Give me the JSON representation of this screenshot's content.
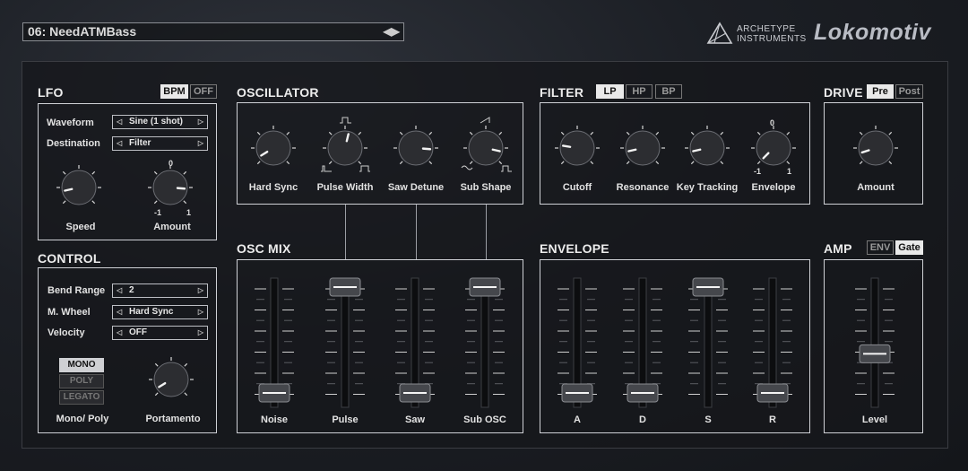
{
  "preset": {
    "name": "06: NeedATMBass",
    "arrows": "◀▶"
  },
  "brand": {
    "line1": "ARCHETYPE",
    "line2": "INSTRUMENTS",
    "product": "Lokomotiv"
  },
  "lfo": {
    "title": "LFO",
    "toggles": [
      {
        "label": "BPM",
        "on": true
      },
      {
        "label": "OFF",
        "on": false
      }
    ],
    "rows": [
      {
        "label": "Waveform",
        "value": "Sine (1 shot)"
      },
      {
        "label": "Destination",
        "value": "Filter"
      }
    ],
    "knobs": [
      {
        "label": "Speed",
        "value": 0.12
      },
      {
        "label": "Amount",
        "value": 0.85,
        "top": "0",
        "min": "-1",
        "max": "1"
      }
    ]
  },
  "control": {
    "title": "CONTROL",
    "rows": [
      {
        "label": "Bend Range",
        "value": "2"
      },
      {
        "label": "M. Wheel",
        "value": "Hard Sync"
      },
      {
        "label": "Velocity",
        "value": "OFF"
      }
    ],
    "modes": [
      {
        "label": "MONO",
        "on": true
      },
      {
        "label": "POLY",
        "on": false
      },
      {
        "label": "LEGATO",
        "on": false
      }
    ],
    "mono_poly_label": "Mono/ Poly",
    "portamento": {
      "label": "Portamento",
      "value": 0.05
    }
  },
  "oscillator": {
    "title": "OSCILLATOR",
    "knobs": [
      {
        "label": "Hard Sync",
        "value": 0.05
      },
      {
        "label": "Pulse Width",
        "value": 0.55
      },
      {
        "label": "Saw Detune",
        "value": 0.85
      },
      {
        "label": "Sub Shape",
        "value": 0.88
      }
    ]
  },
  "osc_mix": {
    "title": "OSC MIX",
    "faders": [
      {
        "label": "Noise",
        "value": 0.0
      },
      {
        "label": "Pulse",
        "value": 1.0
      },
      {
        "label": "Saw",
        "value": 0.0
      },
      {
        "label": "Sub OSC",
        "value": 1.0
      }
    ]
  },
  "filter": {
    "title": "FILTER",
    "types": [
      {
        "label": "LP",
        "on": true
      },
      {
        "label": "HP",
        "on": false
      },
      {
        "label": "BP",
        "on": false
      }
    ],
    "knobs": [
      {
        "label": "Cutoff",
        "value": 0.2
      },
      {
        "label": "Resonance",
        "value": 0.12
      },
      {
        "label": "Key Tracking",
        "value": 0.12
      },
      {
        "label": "Envelope",
        "value": 0.0,
        "top": "0",
        "min": "-1",
        "max": "1"
      }
    ]
  },
  "envelope": {
    "title": "ENVELOPE",
    "faders": [
      {
        "label": "A",
        "value": 0.0
      },
      {
        "label": "D",
        "value": 0.0
      },
      {
        "label": "S",
        "value": 1.0
      },
      {
        "label": "R",
        "value": 0.0
      }
    ]
  },
  "drive": {
    "title": "DRIVE",
    "toggles": [
      {
        "label": "Pre",
        "on": true
      },
      {
        "label": "Post",
        "on": false
      }
    ],
    "knob": {
      "label": "Amount",
      "value": 0.1
    }
  },
  "amp": {
    "title": "AMP",
    "toggles": [
      {
        "label": "ENV",
        "on": false
      },
      {
        "label": "Gate",
        "on": true
      }
    ],
    "fader": {
      "label": "Level",
      "value": 0.37
    }
  }
}
